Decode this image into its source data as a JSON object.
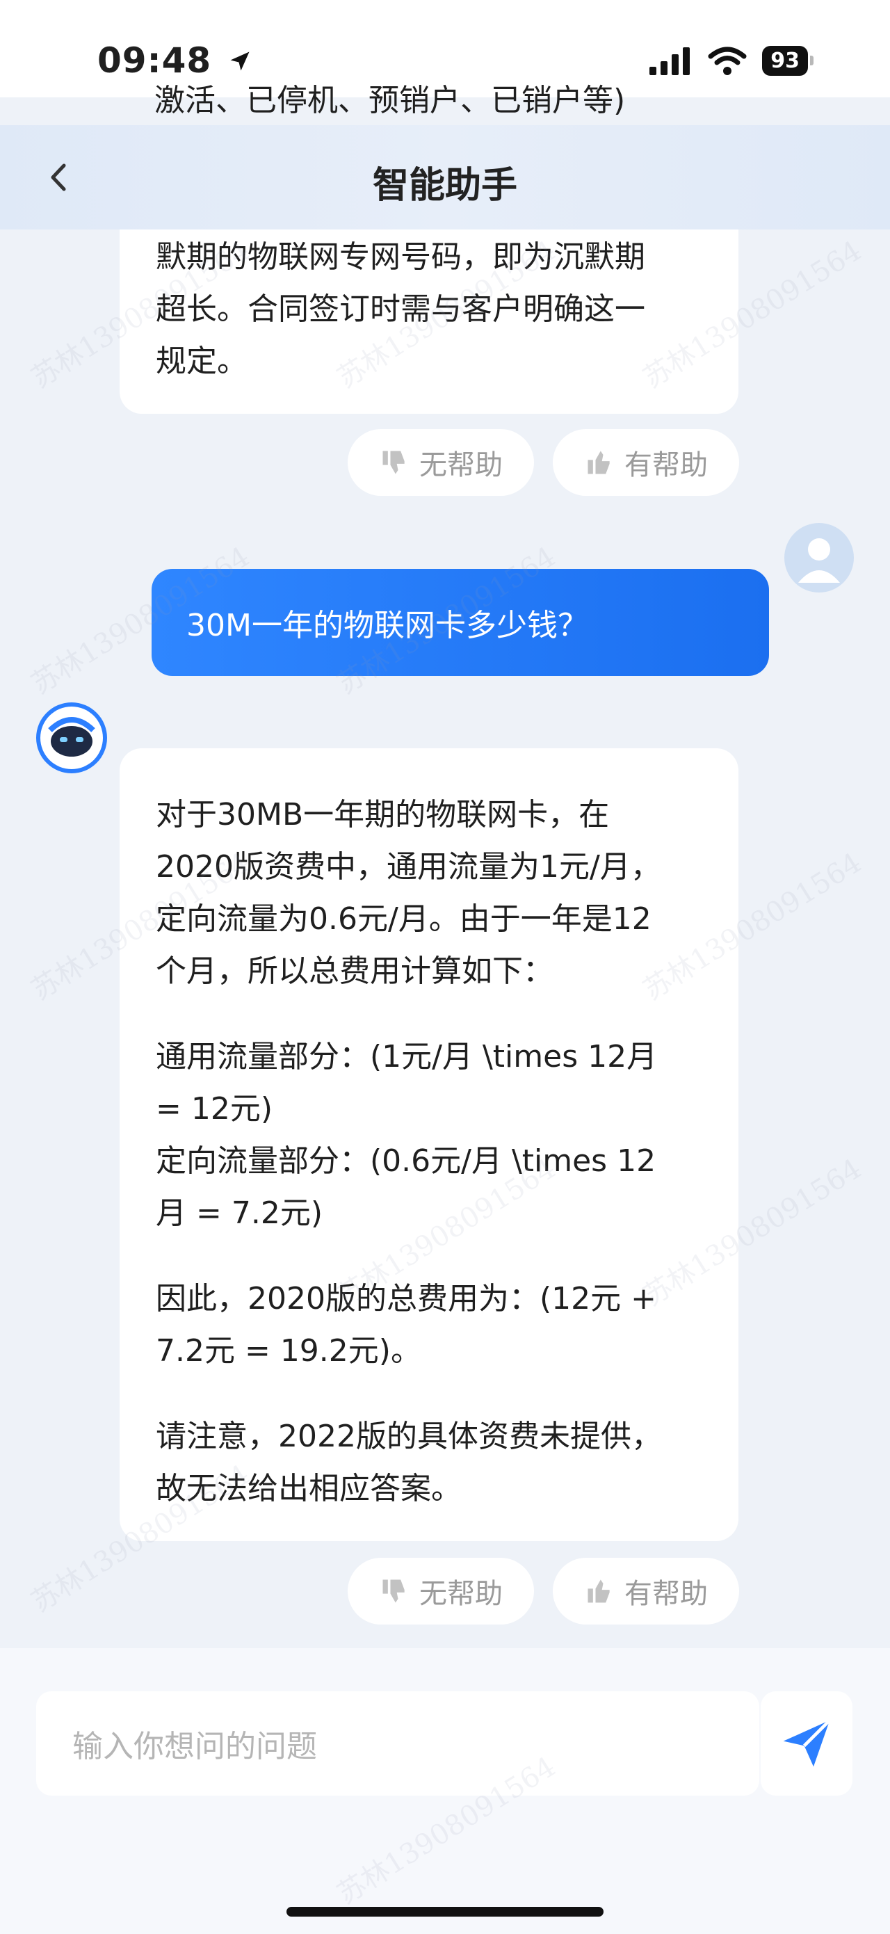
{
  "status_bar": {
    "time": "09:48",
    "battery": "93"
  },
  "top_partial_text": "激活、已停机、预销户、已销户等)",
  "nav": {
    "title": "智能助手"
  },
  "messages": {
    "bot_prev": {
      "lines": [
        "默期的物联网专网号码，即为沉默期",
        "超长。合同签订时需与客户明确这一",
        "规定。"
      ]
    },
    "user": {
      "text": "30M一年的物联网卡多少钱？"
    },
    "bot_answer": {
      "p1": [
        "对于30MB一年期的物联网卡，在",
        "2020版资费中，通用流量为1元/月，",
        "定向流量为0.6元/月。由于一年是12",
        "个月，所以总费用计算如下："
      ],
      "p2": [
        "通用流量部分：(1元/月 \\times 12月",
        "= 12元)",
        "定向流量部分：(0.6元/月 \\times 12",
        "月 = 7.2元)"
      ],
      "p3": [
        "因此，2020版的总费用为：(12元 +",
        "7.2元 = 19.2元)。"
      ],
      "p4": [
        "请注意，2022版的具体资费未提供，",
        "故无法给出相应答案。"
      ]
    }
  },
  "feedback": {
    "unhelpful": "无帮助",
    "helpful": "有帮助"
  },
  "input": {
    "placeholder": "输入你想问的问题"
  },
  "watermark": "苏林13908091564",
  "colors": {
    "user_bubble": "#2f86ff",
    "send_icon": "#2c7fff"
  }
}
